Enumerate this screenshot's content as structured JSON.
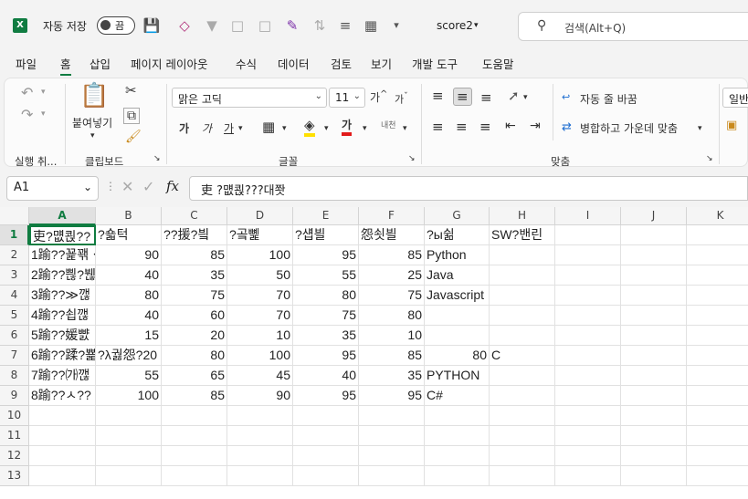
{
  "titlebar": {
    "autosave_label": "자동 저장",
    "autosave_toggle": "끔",
    "filename": "score2",
    "search_placeholder": "검색(Alt+Q)"
  },
  "menu": [
    "파일",
    "홈",
    "삽입",
    "페이지 레이아웃",
    "수식",
    "데이터",
    "검토",
    "보기",
    "개발 도구",
    "도움말"
  ],
  "ribbon": {
    "undo_group": "실행 취...",
    "clipboard_group": "클립보드",
    "paste_label": "붙여넣기",
    "font_group": "글꼴",
    "font_name": "맑은 고딕",
    "font_size": "11",
    "align_group": "맞춤",
    "wrap_text": "자동 줄 바꿈",
    "merge_center": "병합하고 가운데 맞춤",
    "number_format": "일반",
    "bold": "가",
    "italic": "가",
    "underline": "가"
  },
  "formula": {
    "cell_ref": "A1",
    "content": "吏  ?먮쾭???대쫫"
  },
  "grid": {
    "columns": [
      "A",
      "B",
      "C",
      "D",
      "E",
      "F",
      "G",
      "H",
      "I",
      "J",
      "K"
    ],
    "rows": [
      "1",
      "2",
      "3",
      "4",
      "5",
      "6",
      "7",
      "8",
      "9",
      "10",
      "11",
      "12",
      "13"
    ],
    "cells": [
      [
        "吏?먮쾭??",
        "?숇턱",
        "??援?빀",
        "?곸뼱",
        "?섑븰",
        "怨쇳븰",
        "?ы쉶",
        "SW?밴린"
      ],
      [
        "1踰??꾩꽦ㆍ",
        "90",
        "85",
        "100",
        "95",
        "85",
        "Python",
        ""
      ],
      [
        "2踰??쁺?붾",
        "40",
        "35",
        "50",
        "55",
        "25",
        "Java",
        ""
      ],
      [
        "3踰??≫깮",
        "80",
        "75",
        "70",
        "80",
        "75",
        "Javascript",
        ""
      ],
      [
        "4踰??쇱깮",
        "40",
        "60",
        "70",
        "75",
        "80",
        "",
        ""
      ],
      [
        "5踰??媛뺤",
        "15",
        "20",
        "10",
        "35",
        "10",
        "",
        ""
      ],
      [
        "6踰??蹂?뾽",
        "?λ궗怨?20",
        "80",
        "100",
        "95",
        "85",
        "80",
        "C"
      ],
      [
        "7踰??㈎깮",
        "55",
        "65",
        "45",
        "40",
        "35",
        "PYTHON",
        ""
      ],
      [
        "8踰??ㅅ??",
        "100",
        "85",
        "90",
        "95",
        "95",
        "C#",
        ""
      ]
    ]
  }
}
